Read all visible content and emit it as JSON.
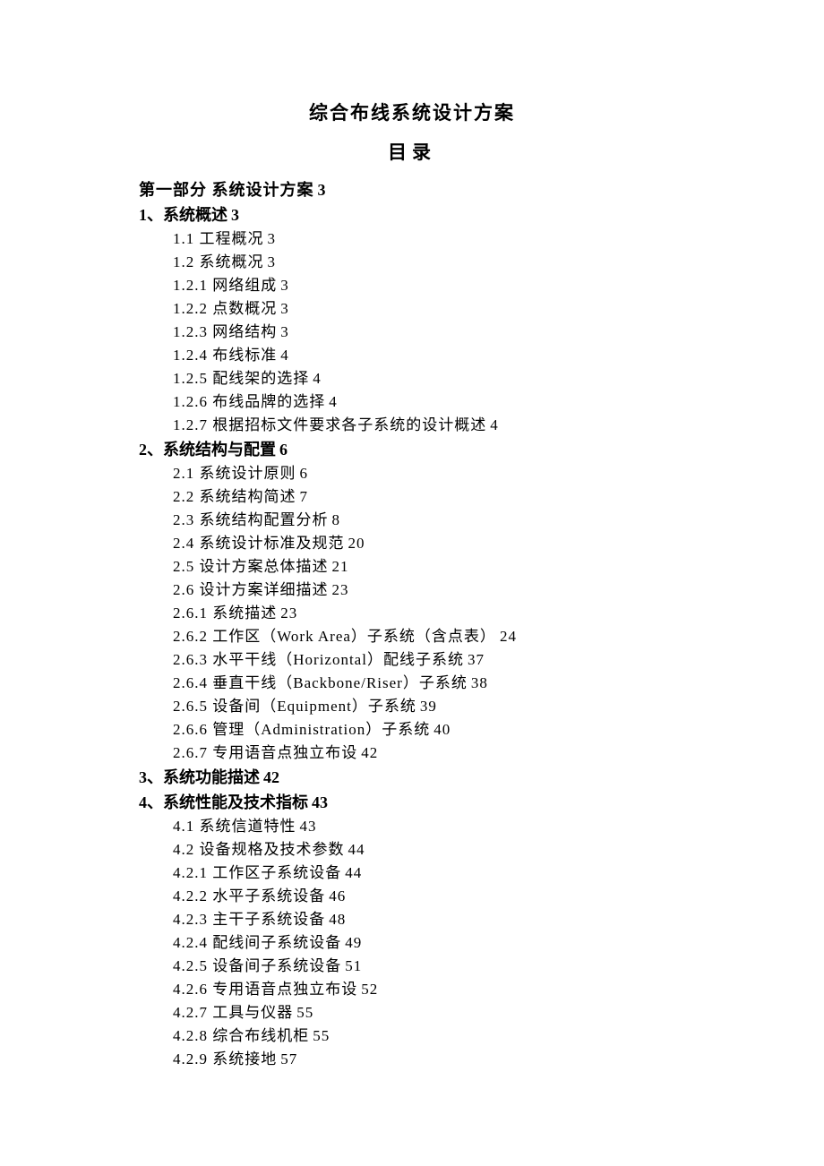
{
  "document_title": "综合布线系统设计方案",
  "toc_label": "目录",
  "toc": [
    {
      "level": 0,
      "label": "第一部分 系统设计方案",
      "page": "3"
    },
    {
      "level": 1,
      "label": "1、系统概述",
      "page": "3"
    },
    {
      "level": 2,
      "label": "1.1 工程概况",
      "page": "3"
    },
    {
      "level": 2,
      "label": "1.2 系统概况",
      "page": "3"
    },
    {
      "level": 2,
      "label": "1.2.1 网络组成",
      "page": "3"
    },
    {
      "level": 2,
      "label": "1.2.2 点数概况",
      "page": "3"
    },
    {
      "level": 2,
      "label": "1.2.3 网络结构",
      "page": "3"
    },
    {
      "level": 2,
      "label": "1.2.4 布线标准",
      "page": "4"
    },
    {
      "level": 2,
      "label": "1.2.5 配线架的选择",
      "page": "4"
    },
    {
      "level": 2,
      "label": "1.2.6 布线品牌的选择",
      "page": "4"
    },
    {
      "level": 2,
      "label": "1.2.7 根据招标文件要求各子系统的设计概述",
      "page": "4"
    },
    {
      "level": 1,
      "label": "2、系统结构与配置",
      "page": "6"
    },
    {
      "level": 2,
      "label": "2.1 系统设计原则",
      "page": "6"
    },
    {
      "level": 2,
      "label": "2.2 系统结构简述",
      "page": "7"
    },
    {
      "level": 2,
      "label": "2.3 系统结构配置分析",
      "page": "8"
    },
    {
      "level": 2,
      "label": "2.4 系统设计标准及规范",
      "page": "20"
    },
    {
      "level": 2,
      "label": "2.5 设计方案总体描述",
      "page": "21"
    },
    {
      "level": 2,
      "label": "2.6 设计方案详细描述",
      "page": "23"
    },
    {
      "level": 2,
      "label": "2.6.1 系统描述",
      "page": "23"
    },
    {
      "level": 2,
      "label": "2.6.2 工作区（Work Area）子系统（含点表）",
      "page": "24"
    },
    {
      "level": 2,
      "label": "2.6.3 水平干线（Horizontal）配线子系统",
      "page": "37"
    },
    {
      "level": 2,
      "label": "2.6.4 垂直干线（Backbone/Riser）子系统",
      "page": "38"
    },
    {
      "level": 2,
      "label": "2.6.5 设备间（Equipment）子系统",
      "page": "39"
    },
    {
      "level": 2,
      "label": "2.6.6 管理（Administration）子系统",
      "page": "40"
    },
    {
      "level": 2,
      "label": "2.6.7 专用语音点独立布设",
      "page": "42"
    },
    {
      "level": 1,
      "label": "3、系统功能描述",
      "page": "42"
    },
    {
      "level": 1,
      "label": "4、系统性能及技术指标",
      "page": "43"
    },
    {
      "level": 2,
      "label": "4.1 系统信道特性",
      "page": "43"
    },
    {
      "level": 2,
      "label": "4.2 设备规格及技术参数",
      "page": "44"
    },
    {
      "level": 2,
      "label": "4.2.1 工作区子系统设备",
      "page": "44"
    },
    {
      "level": 2,
      "label": "4.2.2 水平子系统设备",
      "page": "46"
    },
    {
      "level": 2,
      "label": "4.2.3 主干子系统设备",
      "page": "48"
    },
    {
      "level": 2,
      "label": "4.2.4 配线间子系统设备",
      "page": "49"
    },
    {
      "level": 2,
      "label": "4.2.5 设备间子系统设备",
      "page": "51"
    },
    {
      "level": 2,
      "label": "4.2.6 专用语音点独立布设",
      "page": "52"
    },
    {
      "level": 2,
      "label": "4.2.7 工具与仪器",
      "page": "55"
    },
    {
      "level": 2,
      "label": "4.2.8 综合布线机柜",
      "page": "55"
    },
    {
      "level": 2,
      "label": "4.2.9 系统接地",
      "page": "57"
    }
  ]
}
